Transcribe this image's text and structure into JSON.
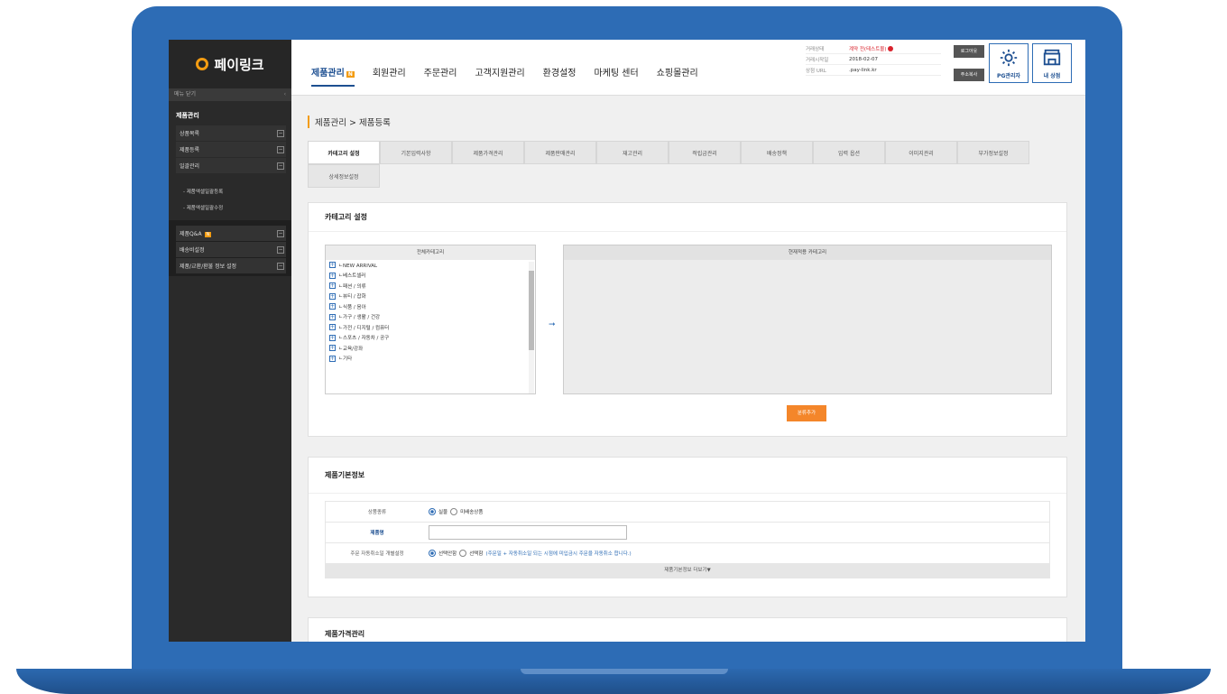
{
  "brand": {
    "name": "페이링크"
  },
  "sidebar": {
    "menu_close": "메뉴 닫기",
    "section_title": "제품관리",
    "items": [
      {
        "label": "상품목록"
      },
      {
        "label": "제품등록"
      },
      {
        "label": "일괄관리"
      }
    ],
    "subitems": [
      {
        "label": "- 제품엑셀일괄등록"
      },
      {
        "label": "- 제품엑셀일괄수정"
      }
    ],
    "group_items": [
      {
        "label": "제품Q&A",
        "badge": "N"
      },
      {
        "label": "배송비설정"
      },
      {
        "label": "제품/교환/환불 정보 설정"
      }
    ]
  },
  "header": {
    "nav": [
      {
        "label": "제품관리",
        "badge": "N"
      },
      {
        "label": "회원관리"
      },
      {
        "label": "주문관리"
      },
      {
        "label": "고객지원관리"
      },
      {
        "label": "환경설정"
      },
      {
        "label": "마케팅 센터"
      },
      {
        "label": "쇼핑몰관리"
      }
    ],
    "info": [
      {
        "key": "거래상태",
        "value": "계약 전(테스트몰)"
      },
      {
        "key": "거래시작일",
        "value": "2018-02-07"
      },
      {
        "key": "상점 URL",
        "value": ".pay-link.kr"
      }
    ],
    "logout": "로그아웃",
    "address_book": "주소복사",
    "pg_admin": "PG관리자",
    "my_shop": "내 상점"
  },
  "content": {
    "breadcrumb": "제품관리 > 제품등록",
    "tabs": [
      {
        "label": "카테고리 설정"
      },
      {
        "label": "기본입력사항"
      },
      {
        "label": "제품가격관리"
      },
      {
        "label": "제품판매관리"
      },
      {
        "label": "재고관리"
      },
      {
        "label": "적립금관리"
      },
      {
        "label": "배송정책"
      },
      {
        "label": "입력 옵션"
      },
      {
        "label": "이미지관리"
      },
      {
        "label": "부가정보설정"
      },
      {
        "label": "상세정보설정"
      }
    ],
    "category_panel": {
      "title": "카테고리 설정",
      "all_categories_head": "전체카테고리",
      "current_categories_head": "현재적용 카테고리",
      "categories": [
        "ㄴNEW ARRIVAL",
        "ㄴ베스트셀러",
        "ㄴ패션 / 의류",
        "ㄴ뷰티 / 잡화",
        "ㄴ식품 / 음아",
        "ㄴ가구 / 생활 / 건강",
        "ㄴ가전 / 디지털 / 컴퓨터",
        "ㄴ스포츠 / 자동차 / 공구",
        "ㄴ교육/강좌",
        "ㄴ기타"
      ],
      "add_button": "분류추가"
    },
    "basic_panel": {
      "title": "제품기본정보",
      "rows": [
        {
          "label": "상품종류",
          "opt1": "실물",
          "opt2": "미배송상품"
        },
        {
          "label": "제품명"
        },
        {
          "label": "주문 자동취소일 개별설정",
          "opt1": "선택안함",
          "opt2": "선택함",
          "note": "(주문일 + 자동취소일 되는 시점에 미입금시 주문을 자동취소 합니다.)"
        }
      ],
      "more": "제품기본정보 더보기▼"
    },
    "price_panel": {
      "title": "제품가격관리"
    }
  }
}
